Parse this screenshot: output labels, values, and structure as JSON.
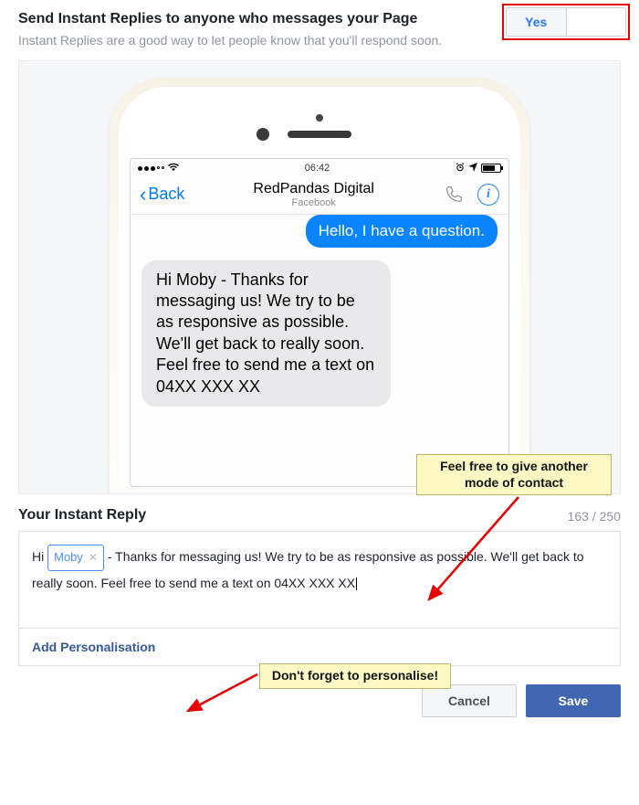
{
  "header": {
    "title": "Send Instant Replies to anyone who messages your Page",
    "subtitle": "Instant Replies are a good way to let people know that you'll respond soon."
  },
  "toggle": {
    "yes": "Yes"
  },
  "phone": {
    "time": "06:42",
    "back": "Back",
    "contact_name": "RedPandas Digital",
    "contact_sub": "Facebook",
    "user_bubble": "Hello, I have a question.",
    "reply_bubble": "Hi Moby - Thanks for messaging us! We try to be as responsive as possible. We'll get back to really soon. Feel free to send me a text on 04XX XXX XX"
  },
  "notes": {
    "contact": "Feel free to give another mode of contact",
    "personalise": "Don't forget to personalise!"
  },
  "editor": {
    "title": "Your Instant Reply",
    "count": "163 / 250",
    "prefix": "Hi ",
    "chip": "Moby",
    "rest": " - Thanks for messaging us! We try to be as responsive as possible. We'll get back to really soon. Feel free to send me a text on 04XX XXX XX",
    "add_personalisation": "Add Personalisation"
  },
  "buttons": {
    "cancel": "Cancel",
    "save": "Save"
  }
}
